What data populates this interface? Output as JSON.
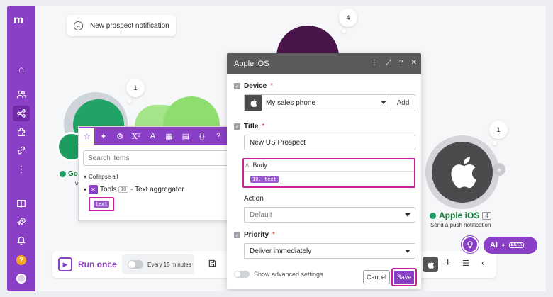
{
  "app": {
    "logo_text": "m"
  },
  "sidebar": {
    "items": [
      {
        "name": "home-icon"
      },
      {
        "name": "team-icon"
      },
      {
        "name": "share-icon"
      },
      {
        "name": "puzzle-icon"
      },
      {
        "name": "link-icon"
      },
      {
        "name": "more-icon"
      },
      {
        "name": "book-icon"
      },
      {
        "name": "rocket-icon"
      },
      {
        "name": "bell-icon"
      },
      {
        "name": "help-icon",
        "label": "?"
      },
      {
        "name": "avatar"
      }
    ]
  },
  "breadcrumb": {
    "label": "New prospect notification"
  },
  "canvas": {
    "bubbles": {
      "google_sheets": "1",
      "slack": "4",
      "apple": "1"
    },
    "google_module": {
      "label": "Go",
      "sub": "w"
    },
    "apple_module": {
      "label": "Apple iOS",
      "badge": "4",
      "sub": "Send a push notification"
    }
  },
  "bottom_bar": {
    "run_once_label": "Run once",
    "schedule_label": "Every 15 minutes"
  },
  "ai": {
    "label": "AI",
    "beta": "BETA"
  },
  "mapping_panel": {
    "search_placeholder": "Search items",
    "collapse_all": "Collapse all",
    "tools": {
      "name": "Tools",
      "badge": "10",
      "suffix": "- Text aggregator"
    },
    "pill": "text"
  },
  "dialog": {
    "title": "Apple iOS",
    "device": {
      "label": "Device",
      "value": "My sales phone",
      "add": "Add"
    },
    "title_field": {
      "label": "Title",
      "value": "New US Prospect"
    },
    "body": {
      "label": "Body",
      "pill": "10. text"
    },
    "action": {
      "label": "Action",
      "value": "Default"
    },
    "priority": {
      "label": "Priority",
      "value": "Deliver immediately"
    },
    "advanced": "Show advanced settings",
    "cancel": "Cancel",
    "save": "Save"
  },
  "colors": {
    "brand": "#8a3fc7",
    "highlight": "#c71f9d",
    "success": "#1e9b5f"
  }
}
